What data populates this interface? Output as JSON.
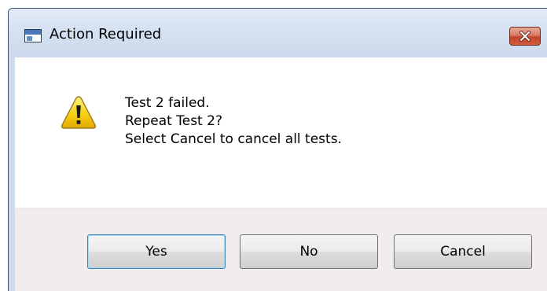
{
  "window": {
    "title": "Action Required",
    "icon": "application-window-icon",
    "close_icon": "close-icon"
  },
  "dialog": {
    "icon": "warning-icon",
    "message_lines": [
      "Test 2 failed.",
      "Repeat Test 2?",
      "Select Cancel to cancel all tests."
    ]
  },
  "buttons": {
    "yes": "Yes",
    "no": "No",
    "cancel": "Cancel",
    "default": "yes"
  },
  "colors": {
    "close_button": "#c3452b",
    "warning_fill": "#f5c800",
    "titlebar": "#d6e2f1"
  }
}
